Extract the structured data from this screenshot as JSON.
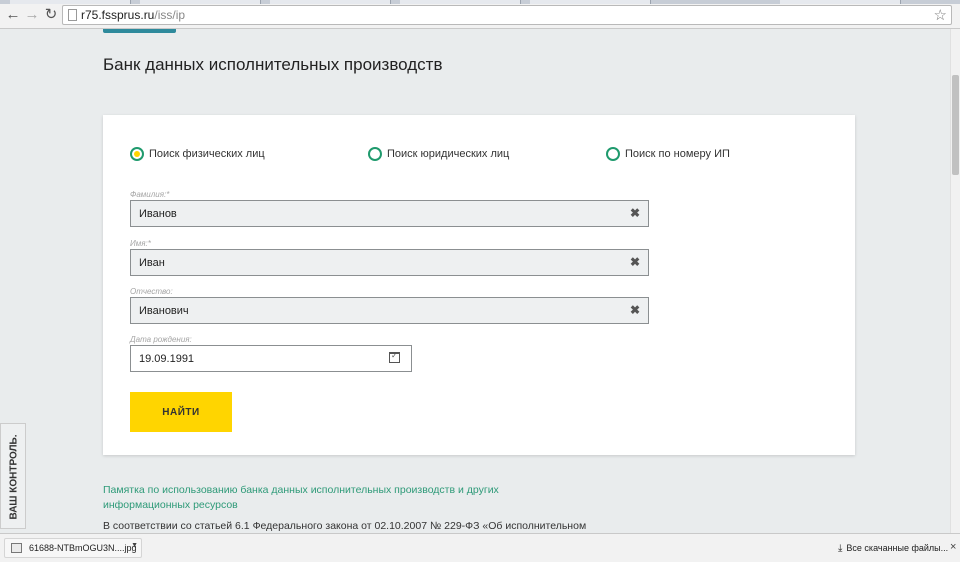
{
  "browser": {
    "url_host": "r75.fssprus.ru",
    "url_path": "/iss/ip",
    "back_icon": "arrow-left-icon",
    "forward_icon": "arrow-right-icon",
    "reload_icon": "reload-icon",
    "bookmark_icon": "star-icon"
  },
  "page": {
    "title": "Банк данных исполнительных производств"
  },
  "search_form": {
    "radios": [
      {
        "label": "Поиск физических лиц",
        "checked": true
      },
      {
        "label": "Поиск юридических лиц",
        "checked": false
      },
      {
        "label": "Поиск по номеру ИП",
        "checked": false
      }
    ],
    "fields": {
      "lastname": {
        "label": "Фамилия:*",
        "value": "Иванов"
      },
      "firstname": {
        "label": "Имя:*",
        "value": "Иван"
      },
      "patronymic": {
        "label": "Отчество:",
        "value": "Иванович"
      },
      "birthdate": {
        "label": "Дата рождения:",
        "value": "19.09.1991"
      }
    },
    "clear_glyph": "✖",
    "submit_label": "НАЙТИ"
  },
  "memo_link": "Памятка по использованию банка данных исполнительных производств и других информационных ресурсов",
  "law_text": "В соответствии со статьей 6.1 Федерального закона от 02.10.2007 № 229-ФЗ «Об исполнительном",
  "side_tab": "ВАШ КОНТРОЛЬ.",
  "download_bar": {
    "file_name": "61688-NTBmOGU3N....jpg",
    "show_all_label": "Все скачанные файлы...",
    "close_glyph": "×"
  },
  "colors": {
    "accent_yellow": "#ffd500",
    "radio_green": "#1f9a6d",
    "link_green": "#2e9a78",
    "teal_button": "#2e8a9c"
  }
}
